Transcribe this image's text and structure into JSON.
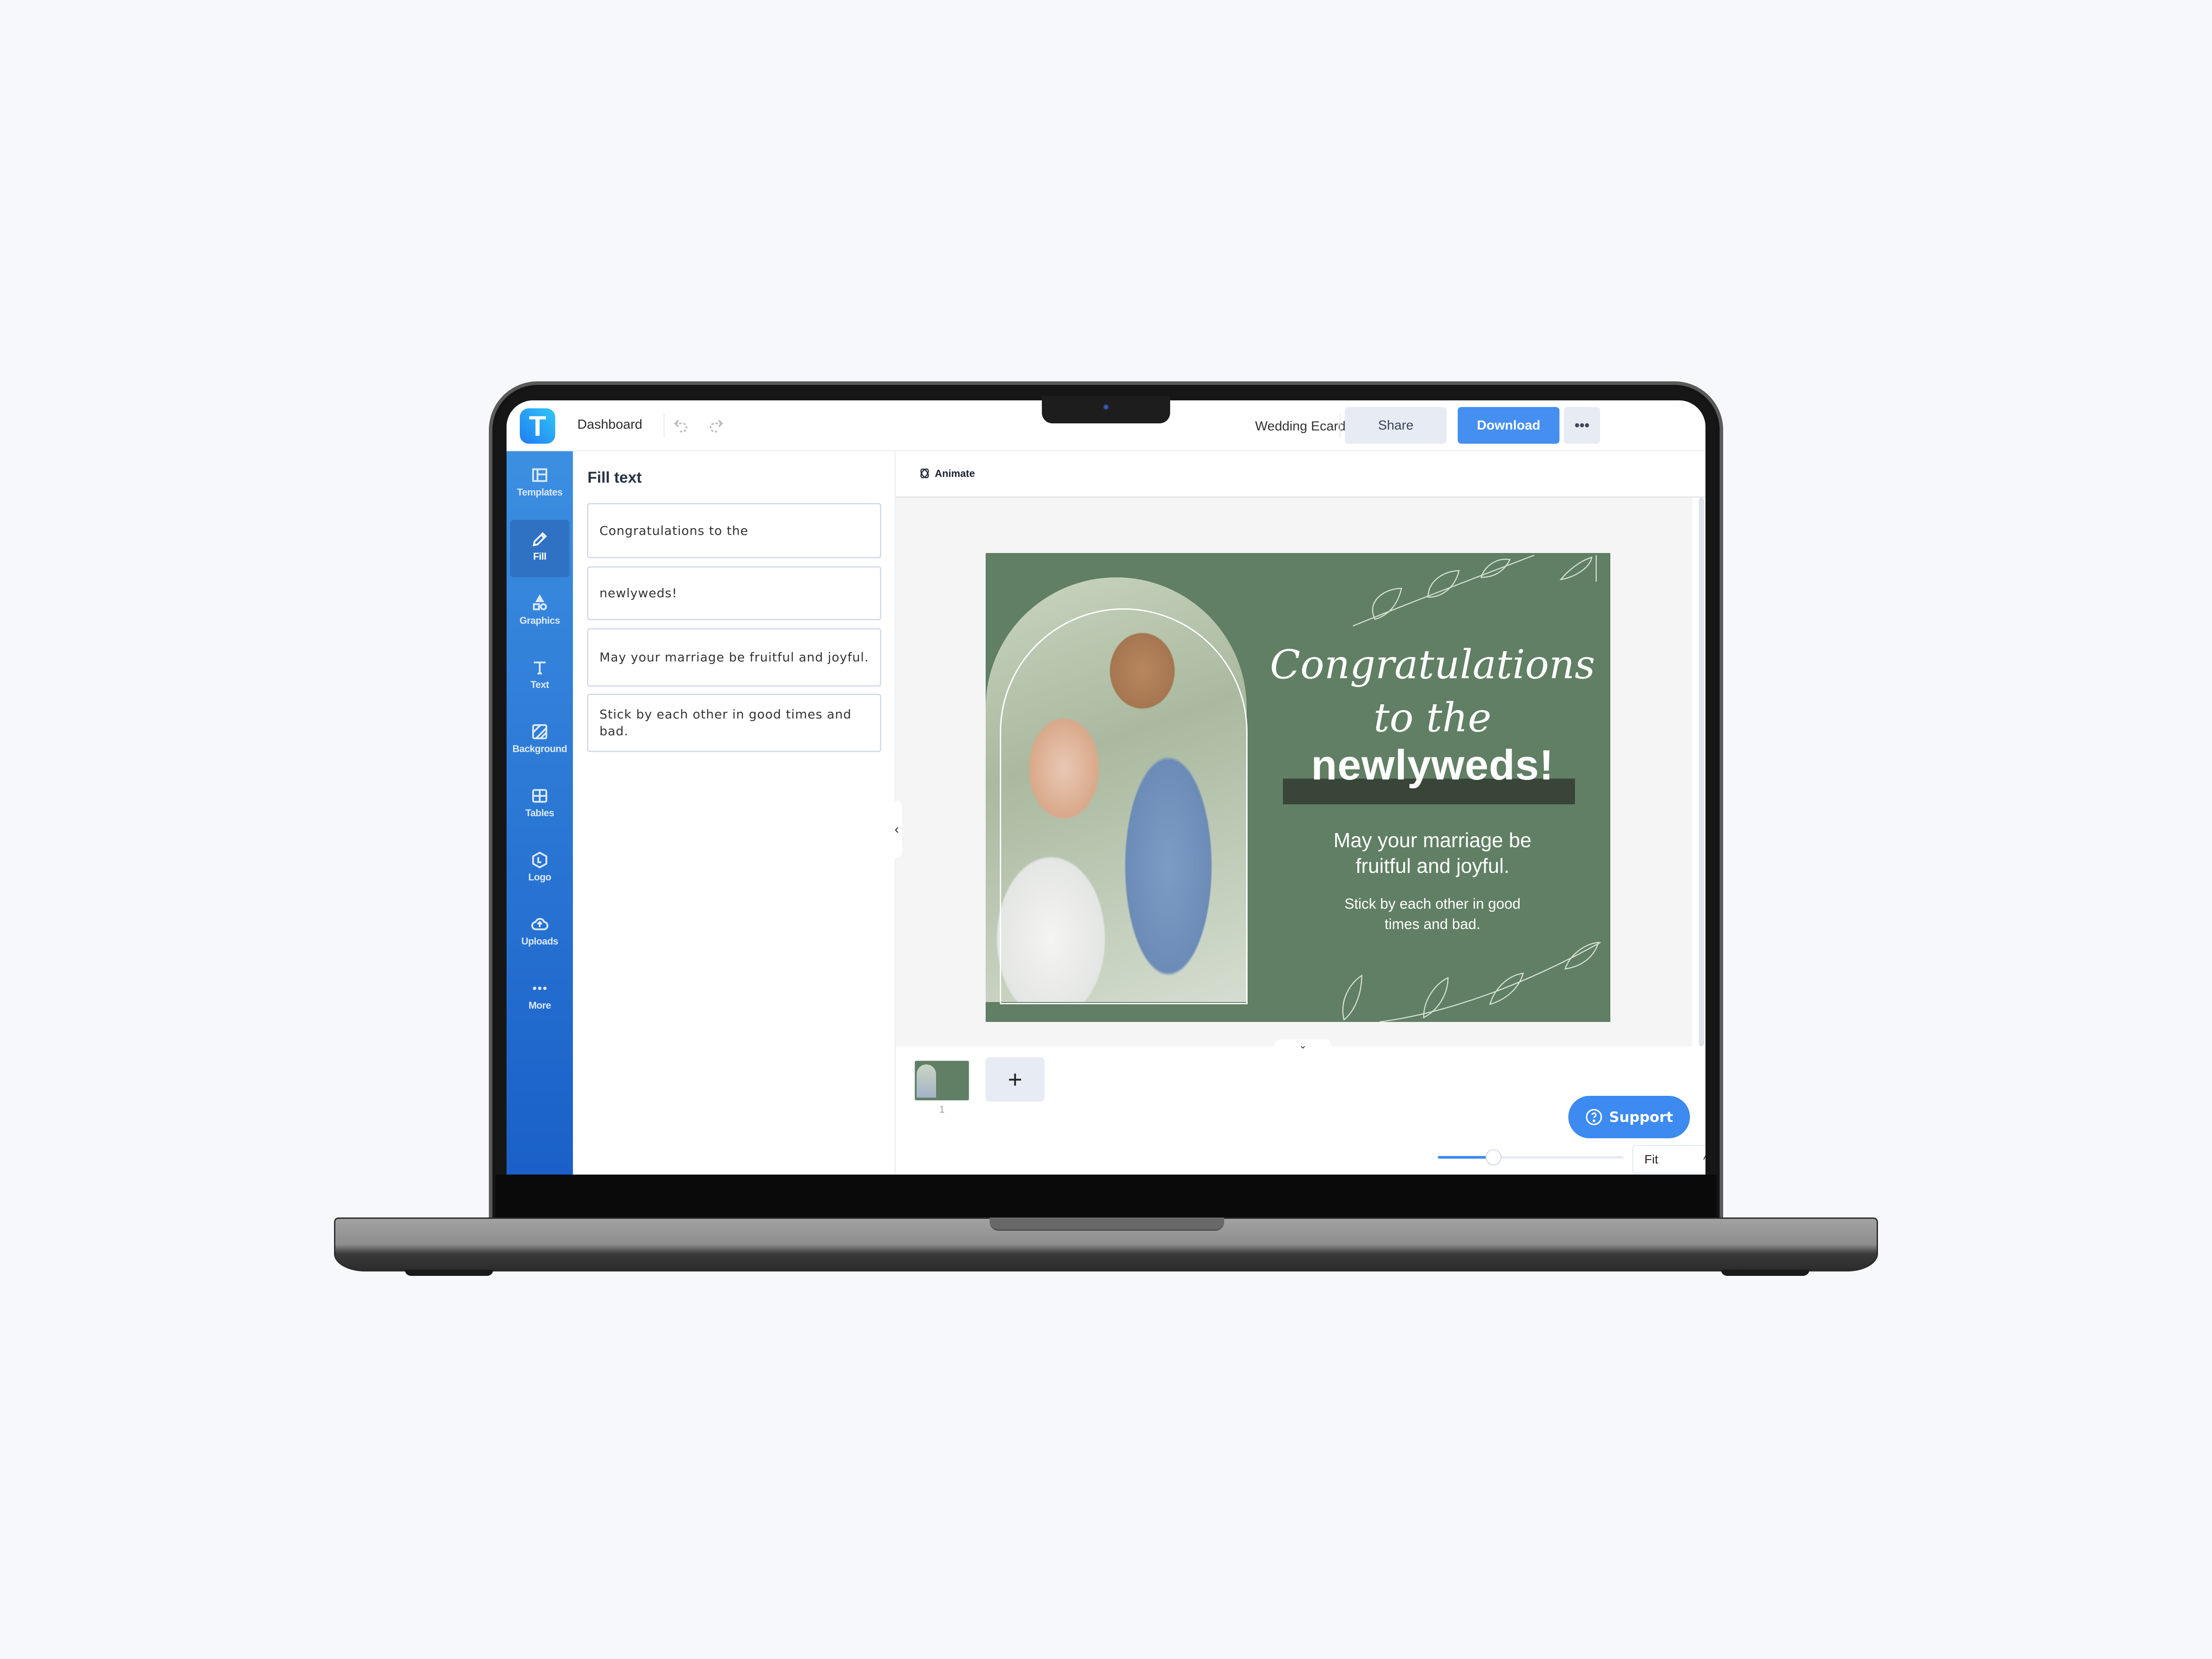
{
  "app": {
    "logo_letter": "T",
    "dashboard_label": "Dashboard",
    "document_title": "Wedding Ecard Template",
    "share_label": "Share",
    "download_label": "Download",
    "more_label": "•••"
  },
  "sidebar": {
    "items": [
      {
        "label": "Templates",
        "icon": "templates-icon"
      },
      {
        "label": "Fill",
        "icon": "pencil-icon",
        "active": true
      },
      {
        "label": "Graphics",
        "icon": "shapes-icon"
      },
      {
        "label": "Text",
        "icon": "text-icon"
      },
      {
        "label": "Background",
        "icon": "background-icon"
      },
      {
        "label": "Tables",
        "icon": "table-icon"
      },
      {
        "label": "Logo",
        "icon": "logo-icon"
      },
      {
        "label": "Uploads",
        "icon": "cloud-upload-icon"
      },
      {
        "label": "More",
        "icon": "more-dots-icon"
      }
    ]
  },
  "fill_panel": {
    "title": "Fill text",
    "fields": [
      "Congratulations to the",
      "newlyweds!",
      "May your marriage be fruitful and joyful.",
      "Stick by each other in good times and bad."
    ]
  },
  "toolbar": {
    "animate_label": "Animate"
  },
  "card": {
    "line1": "Congratulations",
    "line2": "to the",
    "headline": "newlyweds!",
    "message1_line1": "May your marriage be",
    "message1_line2": "fruitful and joyful.",
    "message2_line1": "Stick by each other in good",
    "message2_line2": "times and bad.",
    "background_color": "#607f64",
    "highlight_color": "#384538"
  },
  "pages": {
    "thumbnails": [
      {
        "number": "1"
      }
    ],
    "add_label": "+"
  },
  "footer": {
    "support_label": "Support",
    "zoom_mode": "Fit",
    "zoom_slider_fraction": 0.3,
    "page_count": "1"
  },
  "colors": {
    "accent": "#448ff0",
    "sidebar_top": "#3c8fe1",
    "sidebar_bottom": "#1a60c8"
  }
}
